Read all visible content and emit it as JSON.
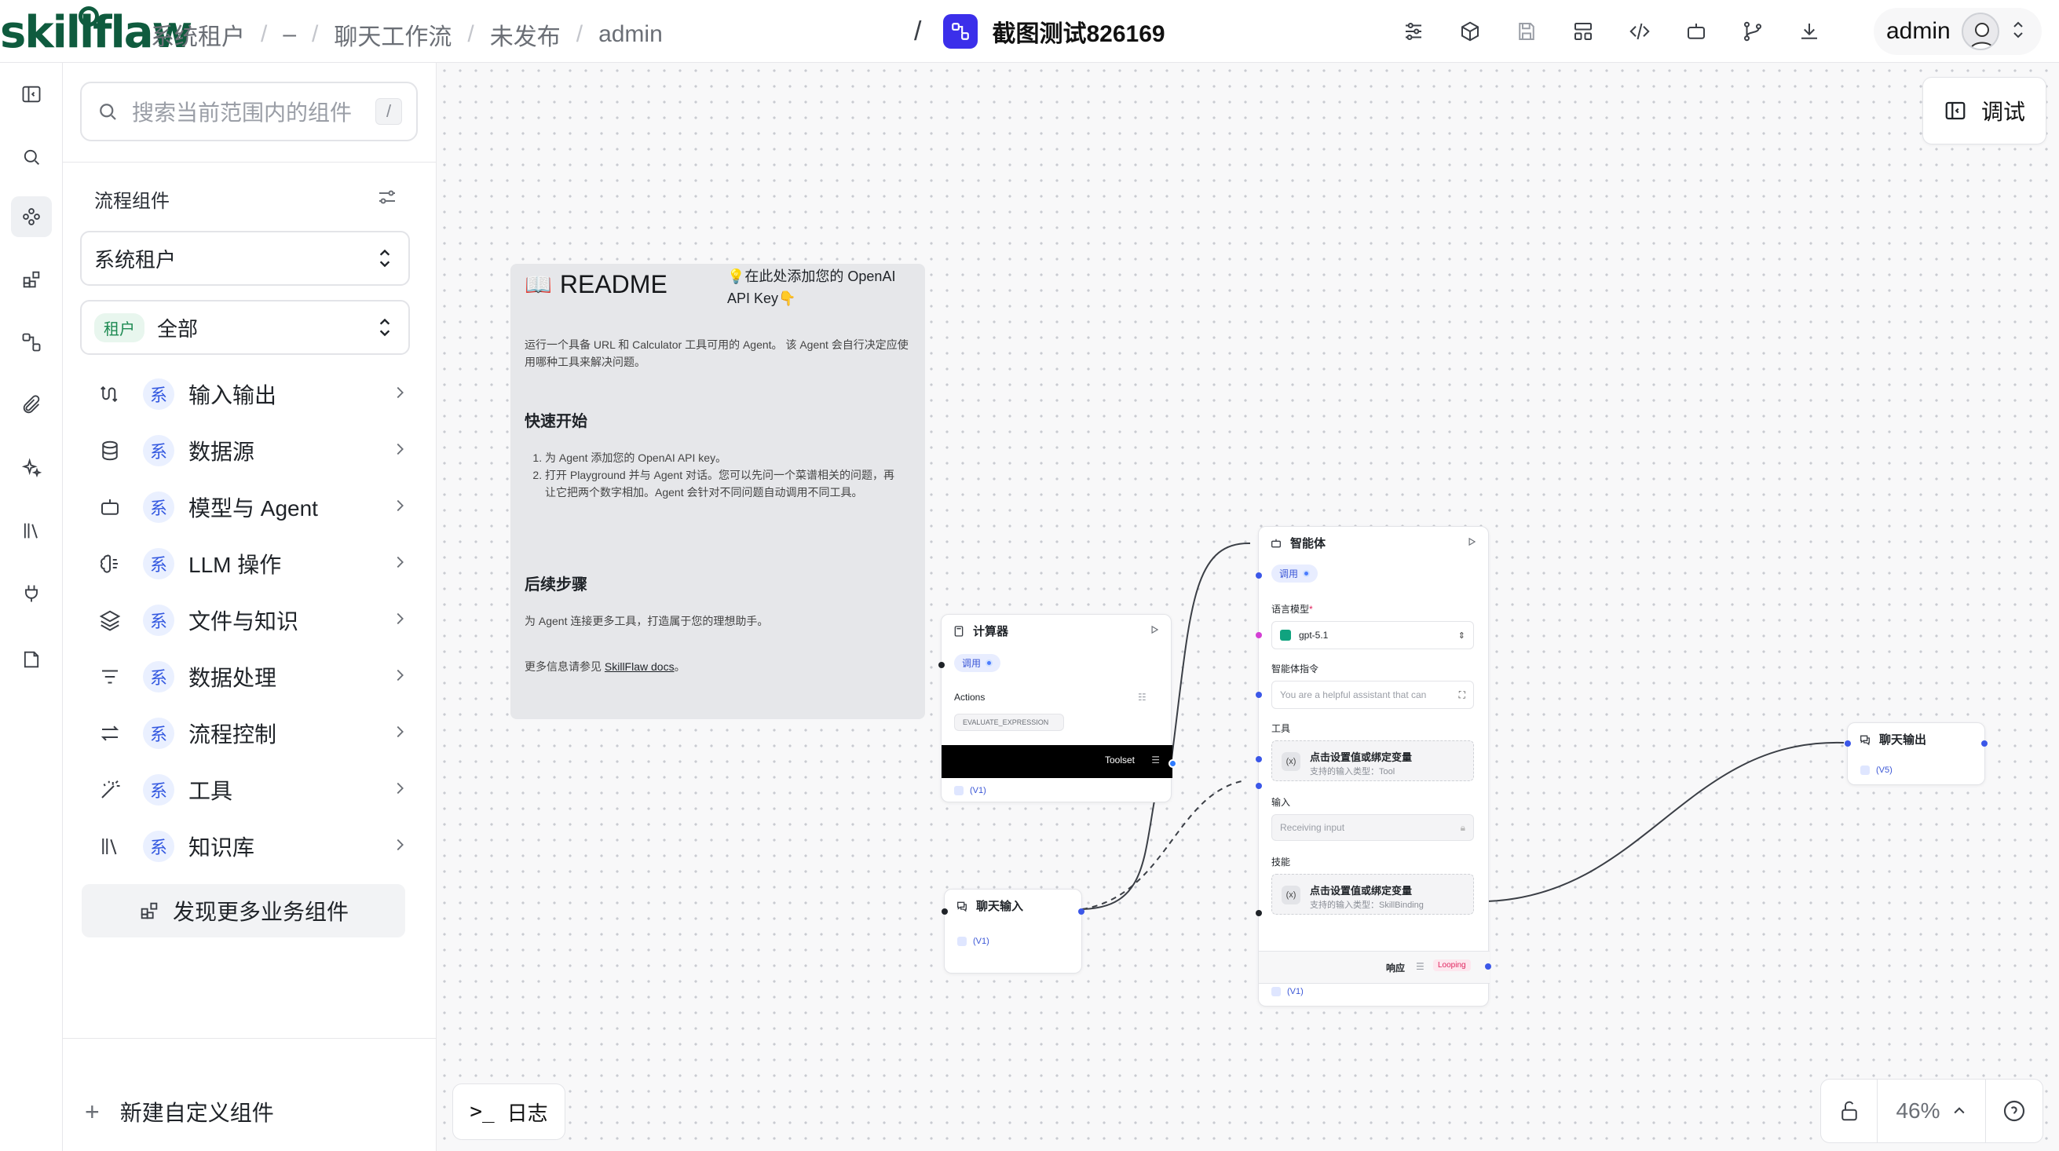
{
  "header": {
    "logo": "skillflaw",
    "breadcrumbs": [
      "系统租户",
      "–",
      "聊天工作流",
      "未发布",
      "admin"
    ],
    "flow_title": "截图测试826169",
    "user_name": "admin",
    "tool_icons": [
      "sliders-icon",
      "cube-icon",
      "save-icon",
      "layout-icon",
      "code-icon",
      "bot-icon",
      "git-branch-icon",
      "download-icon"
    ]
  },
  "sidebar": {
    "search_placeholder": "搜索当前范围内的组件",
    "search_shortcut": "/",
    "section_title": "流程组件",
    "tenant_select": "系统租户",
    "scope_tag": "租户",
    "scope_select": "全部",
    "categories": [
      {
        "icon": "input-output-icon",
        "badge": "系",
        "label": "输入输出"
      },
      {
        "icon": "database-icon",
        "badge": "系",
        "label": "数据源"
      },
      {
        "icon": "bot-icon",
        "badge": "系",
        "label": "模型与 Agent"
      },
      {
        "icon": "brain-icon",
        "badge": "系",
        "label": "LLM 操作"
      },
      {
        "icon": "layers-icon",
        "badge": "系",
        "label": "文件与知识"
      },
      {
        "icon": "filter-icon",
        "badge": "系",
        "label": "数据处理"
      },
      {
        "icon": "arrows-icon",
        "badge": "系",
        "label": "流程控制"
      },
      {
        "icon": "wand-icon",
        "badge": "系",
        "label": "工具"
      },
      {
        "icon": "library-icon",
        "badge": "系",
        "label": "知识库"
      }
    ],
    "discover_label": "发现更多业务组件",
    "new_component_label": "新建自定义组件"
  },
  "canvas": {
    "debug_label": "调试",
    "log_label": "日志",
    "zoom": "46%",
    "readme": {
      "title": "README",
      "tip": "💡在此处添加您的 OpenAI API Key👇",
      "intro": "运行一个具备 URL 和 Calculator 工具可用的 Agent。 该 Agent 会自行决定应使用哪种工具来解决问题。",
      "quickstart_title": "快速开始",
      "steps": [
        "为 Agent 添加您的 OpenAI API key。",
        "打开 Playground 并与 Agent 对话。您可以先问一个菜谱相关的问题，再让它把两个数字相加。Agent 会针对不同问题自动调用不同工具。"
      ],
      "next_title": "后续步骤",
      "next_text": "为 Agent 连接更多工具，打造属于您的理想助手。",
      "docs_prefix": "更多信息请参见 ",
      "docs_link": "SkillFlaw docs",
      "docs_suffix": "。"
    },
    "calculator": {
      "title": "计算器",
      "call": "调用",
      "actions_label": "Actions",
      "action_value": "EVALUATE_EXPRESSION",
      "toolset_label": "Toolset",
      "version": "(V1)"
    },
    "chat_input": {
      "title": "聊天输入",
      "version": "(V1)"
    },
    "agent": {
      "title": "智能体",
      "call": "调用",
      "model_label": "语言模型",
      "model_value": "gpt-5.1",
      "instruction_label": "智能体指令",
      "instruction_value": "You are a helpful assistant that can",
      "tools_label": "工具",
      "tools_bind_title": "点击设置值或绑定变量",
      "tools_bind_hint": "支持的输入类型：Tool",
      "input_label": "输入",
      "input_placeholder": "Receiving input",
      "skills_label": "技能",
      "skills_bind_title": "点击设置值或绑定变量",
      "skills_bind_hint": "支持的输入类型：SkillBinding",
      "response_label": "响应",
      "looping_label": "Looping",
      "version": "(V1)"
    },
    "chat_output": {
      "title": "聊天输出",
      "version": "(V5)"
    }
  }
}
